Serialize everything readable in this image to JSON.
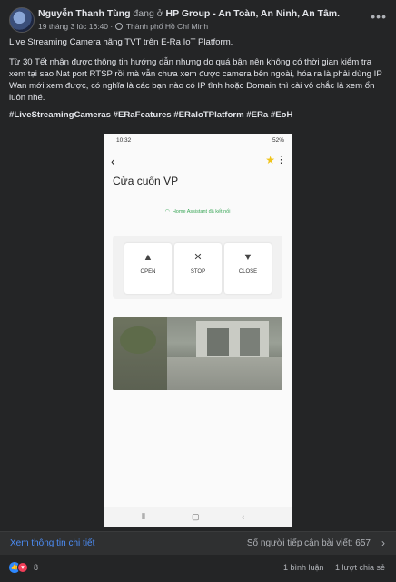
{
  "post": {
    "author": "Nguyễn Thanh Tùng",
    "at_text": "đang ở",
    "location": "HP Group - An Toàn, An Ninh, An Tâm.",
    "date": "19 tháng 3 lúc 16:40",
    "city": "Thành phố Hồ Chí Minh",
    "more_icon": "ellipsis-icon",
    "paragraph1": "Live Streaming Camera hãng TVT trên E-Ra IoT Platform.",
    "paragraph2": "Từ 30 Tết nhận được thông tin hướng dẫn nhưng do quá bận nên không có thời gian kiểm tra xem tại sao Nat port RTSP rồi mà vẫn chưa xem được camera bên ngoài, hóa ra là phải dùng IP Wan mới xem được, có nghĩa là các bạn nào có IP tĩnh hoặc Domain thì cài vô chắc là xem ổn luôn nhé.",
    "hashtags": "#LiveStreamingCameras #ERaFeatures #ERaIoTPlatform #ERa #EoH"
  },
  "phone": {
    "time": "10:32",
    "battery": "52%",
    "device_title": "Cửa cuốn VP",
    "connection": "Home Assistant đã kết nối",
    "controls": [
      {
        "label": "OPEN",
        "icon": "triangle-up-icon"
      },
      {
        "label": "STOP",
        "icon": "x-icon"
      },
      {
        "label": "CLOSE",
        "icon": "triangle-down-icon"
      }
    ],
    "accent_star": "#f0c419",
    "accent_connected": "#3aa657"
  },
  "footer": {
    "details_link": "Xem thông tin chi tiết",
    "reach": "Số người tiếp cận bài viết: 657",
    "reaction_count": "8",
    "comments": "1 bình luận",
    "shares": "1 lượt chia sẻ"
  }
}
